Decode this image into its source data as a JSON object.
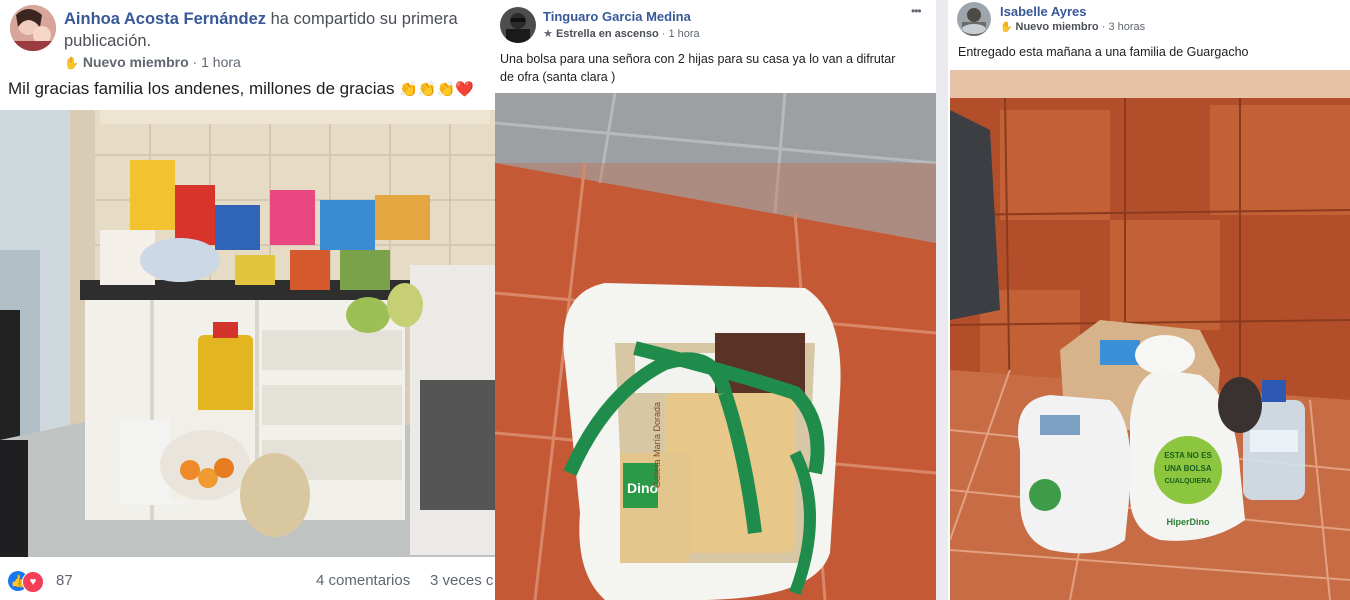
{
  "posts": [
    {
      "author": "Ainhoa Acosta Fernández",
      "action": "ha compartido su primera",
      "action_cont": "publicación.",
      "badge": "Nuevo miembro",
      "time": "1 hora",
      "text": "Mil gracias familia los andenes, millones de gracias",
      "emojis": "👏👏👏❤️",
      "reaction_count": "87",
      "comments": "4 comentarios",
      "shares": "3 veces c"
    },
    {
      "author": "Tinguaro Garcia Medina",
      "badge": "Estrella en ascenso",
      "time": "1 hora",
      "text_line1": "Una bolsa para una señora con 2 hijas para su casa ya lo van a difrutar",
      "text_line2": "de ofra (santa clara )",
      "more": "•••",
      "bag_brand": "Dino",
      "bag_label": "Galleta María Dorada"
    },
    {
      "author": "Isabelle Ayres",
      "badge": "Nuevo miembro",
      "time": "3 horas",
      "text": "Entregado esta mañana a una familia de Guargacho",
      "bag_text_1": "ESTA NO ES",
      "bag_text_2": "UNA BOLSA",
      "bag_text_3": "CUALQUIERA",
      "bag_brand": "HiperDino"
    }
  ],
  "colors": {
    "link": "#385898",
    "meta": "#606770",
    "like": "#1877f2",
    "love": "#f33e58"
  }
}
